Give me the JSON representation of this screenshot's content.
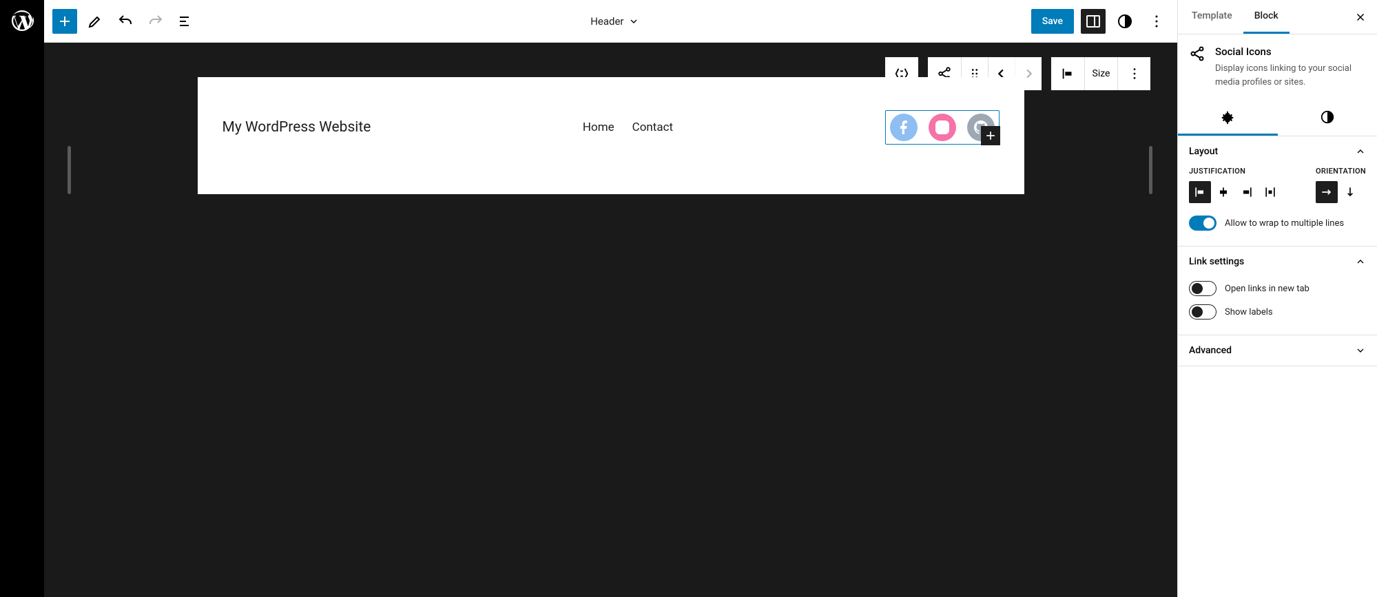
{
  "toolbar": {
    "doc_title": "Header",
    "save_label": "Save"
  },
  "canvas": {
    "site_title": "My WordPress Website",
    "nav": [
      "Home",
      "Contact"
    ]
  },
  "block_toolbar": {
    "size_label": "Size"
  },
  "panel": {
    "tabs": {
      "template": "Template",
      "block": "Block"
    },
    "block_name": "Social Icons",
    "block_desc": "Display icons linking to your social media profiles or sites.",
    "sections": {
      "layout": {
        "title": "Layout",
        "justification_label": "Justification",
        "orientation_label": "Orientation",
        "wrap_label": "Allow to wrap to multiple lines"
      },
      "link": {
        "title": "Link settings",
        "newtab_label": "Open links in new tab",
        "labels_label": "Show labels"
      },
      "advanced": {
        "title": "Advanced"
      }
    }
  }
}
